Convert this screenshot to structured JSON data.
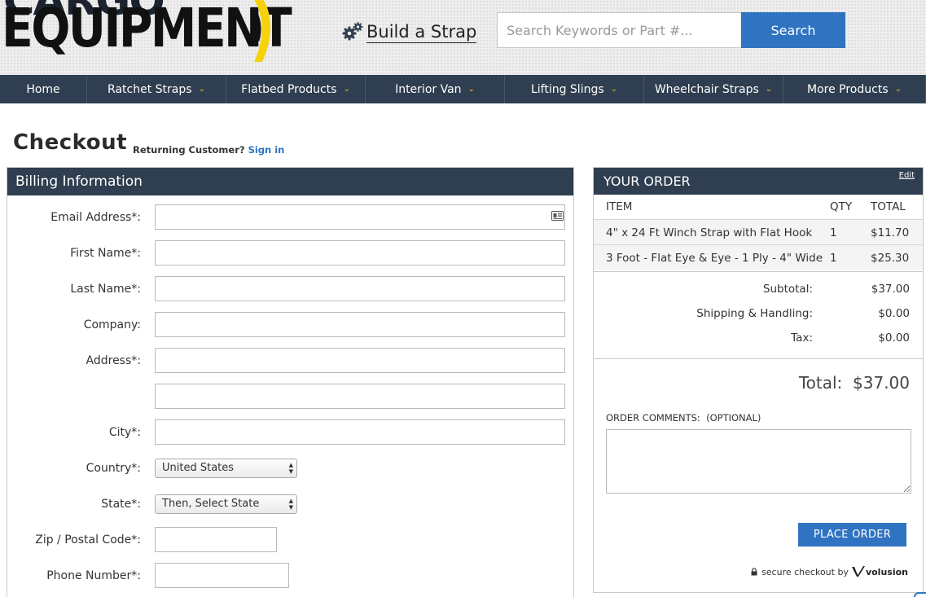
{
  "header": {
    "logo_top": "CARGO",
    "logo_main": "EQUIPMENT",
    "build_strap": "Build a Strap",
    "search_placeholder": "Search Keywords or Part #...",
    "search_button": "Search"
  },
  "nav": [
    {
      "label": "Home",
      "has_menu": false
    },
    {
      "label": "Ratchet Straps",
      "has_menu": true
    },
    {
      "label": "Flatbed Products",
      "has_menu": true
    },
    {
      "label": "Interior Van",
      "has_menu": true
    },
    {
      "label": "Lifting Slings",
      "has_menu": true
    },
    {
      "label": "Wheelchair Straps",
      "has_menu": true
    },
    {
      "label": "More Products",
      "has_menu": true
    }
  ],
  "checkout": {
    "title": "Checkout",
    "returning": "Returning Customer?",
    "sign_in": "Sign in"
  },
  "billing": {
    "heading": "Billing Information",
    "fields": {
      "email": "Email Address*:",
      "first_name": "First Name*:",
      "last_name": "Last Name*:",
      "company": "Company:",
      "address": "Address*:",
      "city": "City*:",
      "country": "Country*:",
      "state": "State*:",
      "zip": "Zip / Postal Code*:",
      "phone": "Phone Number*:"
    },
    "country_value": "United States",
    "state_value": "Then, Select State"
  },
  "order": {
    "heading": "YOUR ORDER",
    "edit": "Edit",
    "columns": {
      "item": "ITEM",
      "qty": "QTY",
      "total": "TOTAL"
    },
    "items": [
      {
        "name": "4\" x 24 Ft Winch Strap with Flat Hook",
        "qty": "1",
        "total": "$11.70"
      },
      {
        "name": "3 Foot - Flat Eye & Eye - 1 Ply - 4\" Wide",
        "qty": "1",
        "total": "$25.30"
      }
    ],
    "subtotal_label": "Subtotal:",
    "subtotal": "$37.00",
    "shipping_label": "Shipping & Handling:",
    "shipping": "$0.00",
    "tax_label": "Tax:",
    "tax": "$0.00",
    "total_label": "Total:",
    "total": "$37.00",
    "comments_label": "ORDER COMMENTS:  (OPTIONAL)",
    "place_order": "PLACE ORDER",
    "secure_text": "secure checkout by",
    "secure_brand": "volusion"
  },
  "colors": {
    "nav_bg": "#2f3e50",
    "accent_blue": "#2f73c1",
    "chevron_yellow": "#f2c400"
  }
}
